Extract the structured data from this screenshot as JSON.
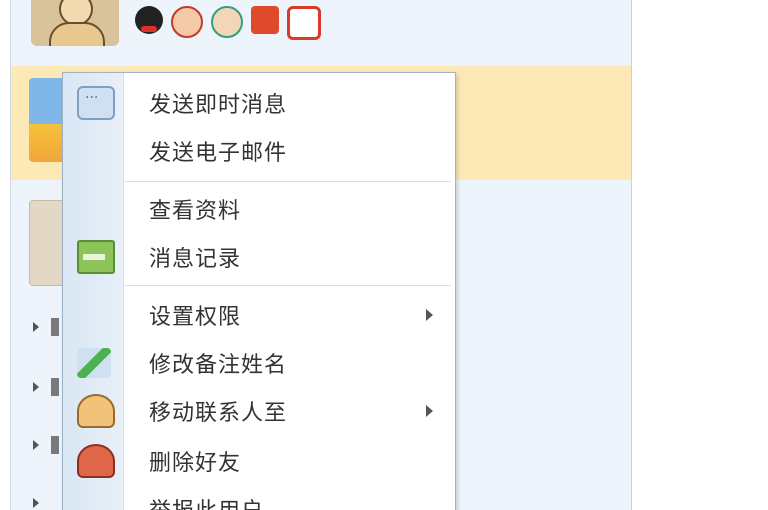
{
  "menu": {
    "items": [
      {
        "label": "发送即时消息",
        "icon": "message-bubble-icon"
      },
      {
        "label": "发送电子邮件",
        "icon": ""
      },
      {
        "label": "查看资料",
        "icon": ""
      },
      {
        "label": "消息记录",
        "icon": "message-history-icon"
      },
      {
        "label": "设置权限",
        "icon": "",
        "submenu": true
      },
      {
        "label": "修改备注姓名",
        "icon": "edit-note-icon"
      },
      {
        "label": "移动联系人至",
        "icon": "move-contact-icon",
        "submenu": true
      },
      {
        "label": "删除好友",
        "icon": "delete-friend-icon"
      },
      {
        "label": "举报此用户",
        "icon": ""
      }
    ]
  },
  "status_icons": [
    "qq-penguin-icon",
    "friend-icon",
    "contact-icon",
    "mailbox-icon",
    "qzone-home-icon"
  ],
  "colors": {
    "panel_bg": "#eef4fb",
    "highlight_row": "#fde9b6",
    "menu_border": "#9fb2c6",
    "menu_gutter": "#d9e6f3"
  }
}
